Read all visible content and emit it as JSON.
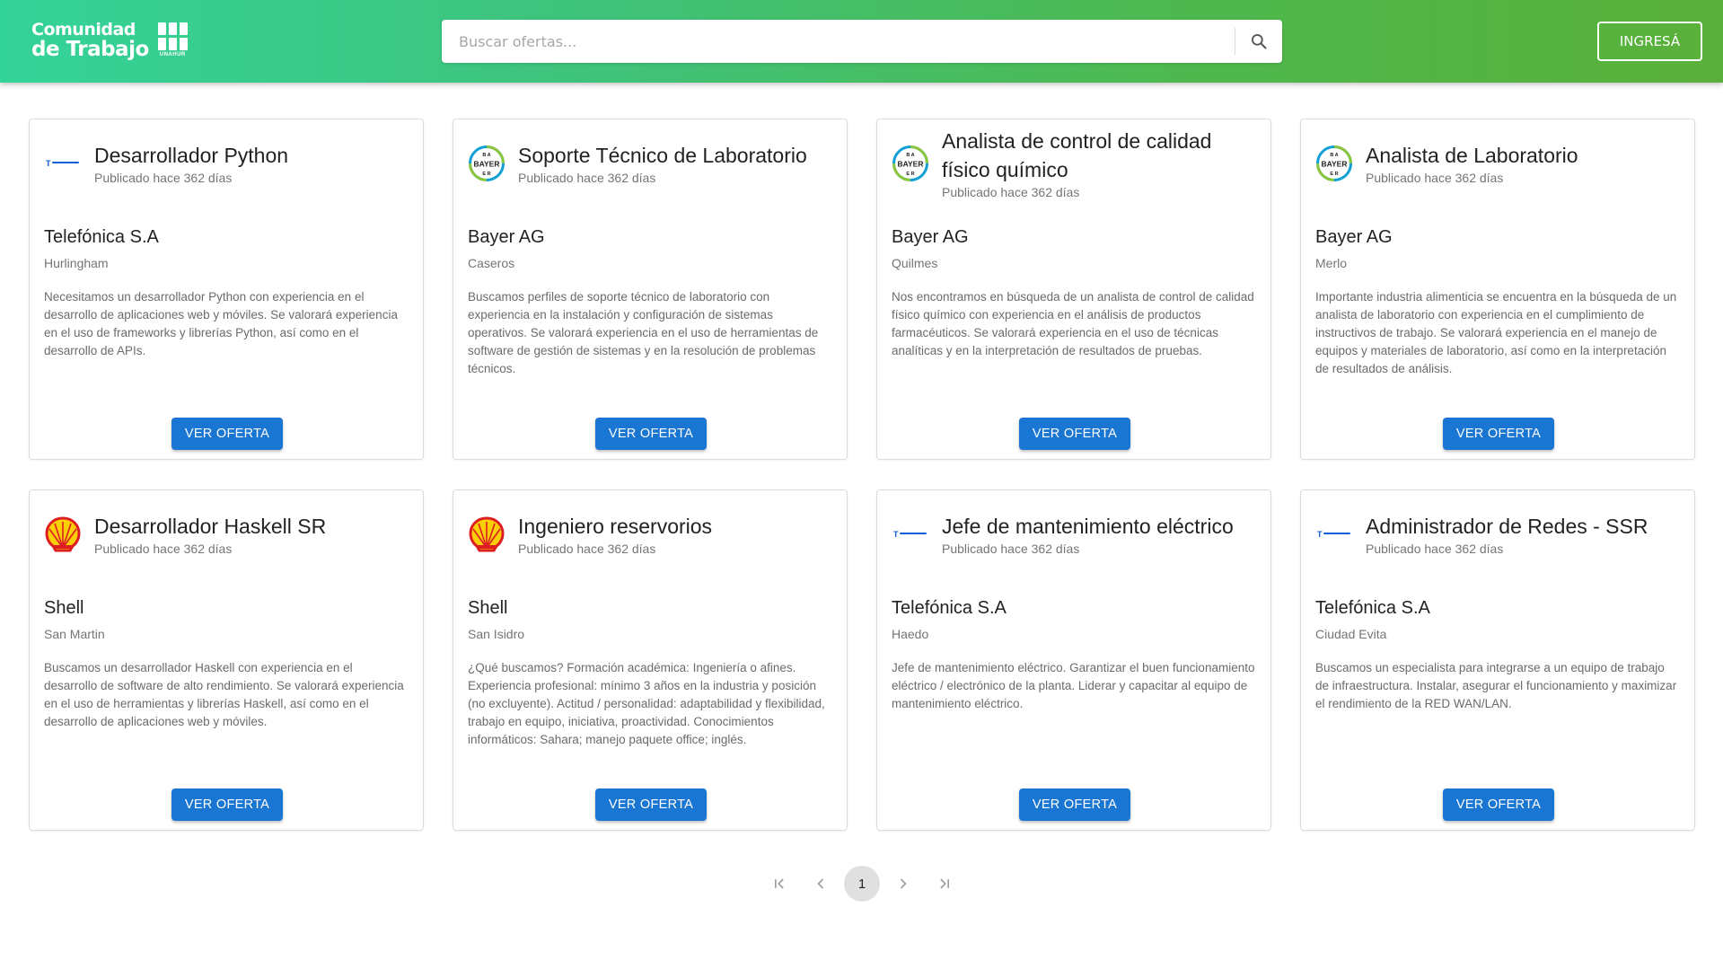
{
  "header": {
    "logo_line1": "Comunidad",
    "logo_line2": "de Trabajo",
    "logo_sub": "UNAHUR",
    "search_placeholder": "Buscar ofertas...",
    "login_label": "INGRESÁ"
  },
  "colors": {
    "header_gradient_start": "#34d399",
    "header_gradient_end": "#5ab03a",
    "button_primary": "#1976d2"
  },
  "offers": [
    {
      "logo": "telefonica-logo",
      "title": "Desarrollador Python",
      "published": "Publicado hace 362 días",
      "company": "Telefónica S.A",
      "location": "Hurlingham",
      "description": "Necesitamos un desarrollador Python con experiencia en el desarrollo de aplicaciones web y móviles. Se valorará experiencia en el uso de frameworks y librerías Python, así como en el desarrollo de APIs.",
      "button": "VER OFERTA"
    },
    {
      "logo": "bayer-logo",
      "title": "Soporte Técnico de Laboratorio",
      "published": "Publicado hace 362 días",
      "company": "Bayer AG",
      "location": "Caseros",
      "description": "Buscamos perfiles de soporte técnico de laboratorio con experiencia en la instalación y configuración de sistemas operativos. Se valorará experiencia en el uso de herramientas de software de gestión de sistemas y en la resolución de problemas técnicos.",
      "button": "VER OFERTA"
    },
    {
      "logo": "bayer-logo",
      "title": "Analista de control de calidad físico químico",
      "published": "Publicado hace 362 días",
      "company": "Bayer AG",
      "location": "Quilmes",
      "description": "Nos encontramos en búsqueda de un analista de control de calidad físico químico con experiencia en el análisis de productos farmacéuticos. Se valorará experiencia en el uso de técnicas analíticas y en la interpretación de resultados de pruebas.",
      "button": "VER OFERTA"
    },
    {
      "logo": "bayer-logo",
      "title": "Analista de Laboratorio",
      "published": "Publicado hace 362 días",
      "company": "Bayer AG",
      "location": "Merlo",
      "description": "Importante industria alimenticia se encuentra en la búsqueda de un analista de laboratorio con experiencia en el cumplimiento de instructivos de trabajo. Se valorará experiencia en el manejo de equipos y materiales de laboratorio, así como en la interpretación de resultados de análisis.",
      "button": "VER OFERTA"
    },
    {
      "logo": "shell-logo",
      "title": "Desarrollador Haskell SR",
      "published": "Publicado hace 362 días",
      "company": "Shell",
      "location": "San Martin",
      "description": "Buscamos un desarrollador Haskell con experiencia en el desarrollo de software de alto rendimiento. Se valorará experiencia en el uso de herramientas y librerías Haskell, así como en el desarrollo de aplicaciones web y móviles.",
      "button": "VER OFERTA"
    },
    {
      "logo": "shell-logo",
      "title": "Ingeniero reservorios",
      "published": "Publicado hace 362 días",
      "company": "Shell",
      "location": "San Isidro",
      "description": "¿Qué buscamos? Formación académica: Ingeniería o afines. Experiencia profesional: mínimo 3 años en la industria y posición (no excluyente). Actitud / personalidad: adaptabilidad y flexibilidad, trabajo en equipo, iniciativa, proactividad. Conocimientos informáticos: Sahara; manejo paquete office; inglés.",
      "button": "VER OFERTA"
    },
    {
      "logo": "telefonica-logo",
      "title": "Jefe de mantenimiento eléctrico",
      "published": "Publicado hace 362 días",
      "company": "Telefónica S.A",
      "location": "Haedo",
      "description": "Jefe de mantenimiento eléctrico. Garantizar el buen funcionamiento eléctrico / electrónico de la planta. Liderar y capacitar al equipo de mantenimiento eléctrico.",
      "button": "VER OFERTA"
    },
    {
      "logo": "telefonica-logo",
      "title": "Administrador de Redes - SSR",
      "published": "Publicado hace 362 días",
      "company": "Telefónica S.A",
      "location": "Ciudad Evita",
      "description": "Buscamos un especialista para integrarse a un equipo de trabajo de infraestructura. Instalar, asegurar el funcionamiento y maximizar el rendimiento de la RED WAN/LAN.",
      "button": "VER OFERTA"
    }
  ],
  "pagination": {
    "first_icon": "first-page-icon",
    "prev_icon": "chevron-left-icon",
    "current_page": "1",
    "next_icon": "chevron-right-icon",
    "last_icon": "last-page-icon"
  }
}
